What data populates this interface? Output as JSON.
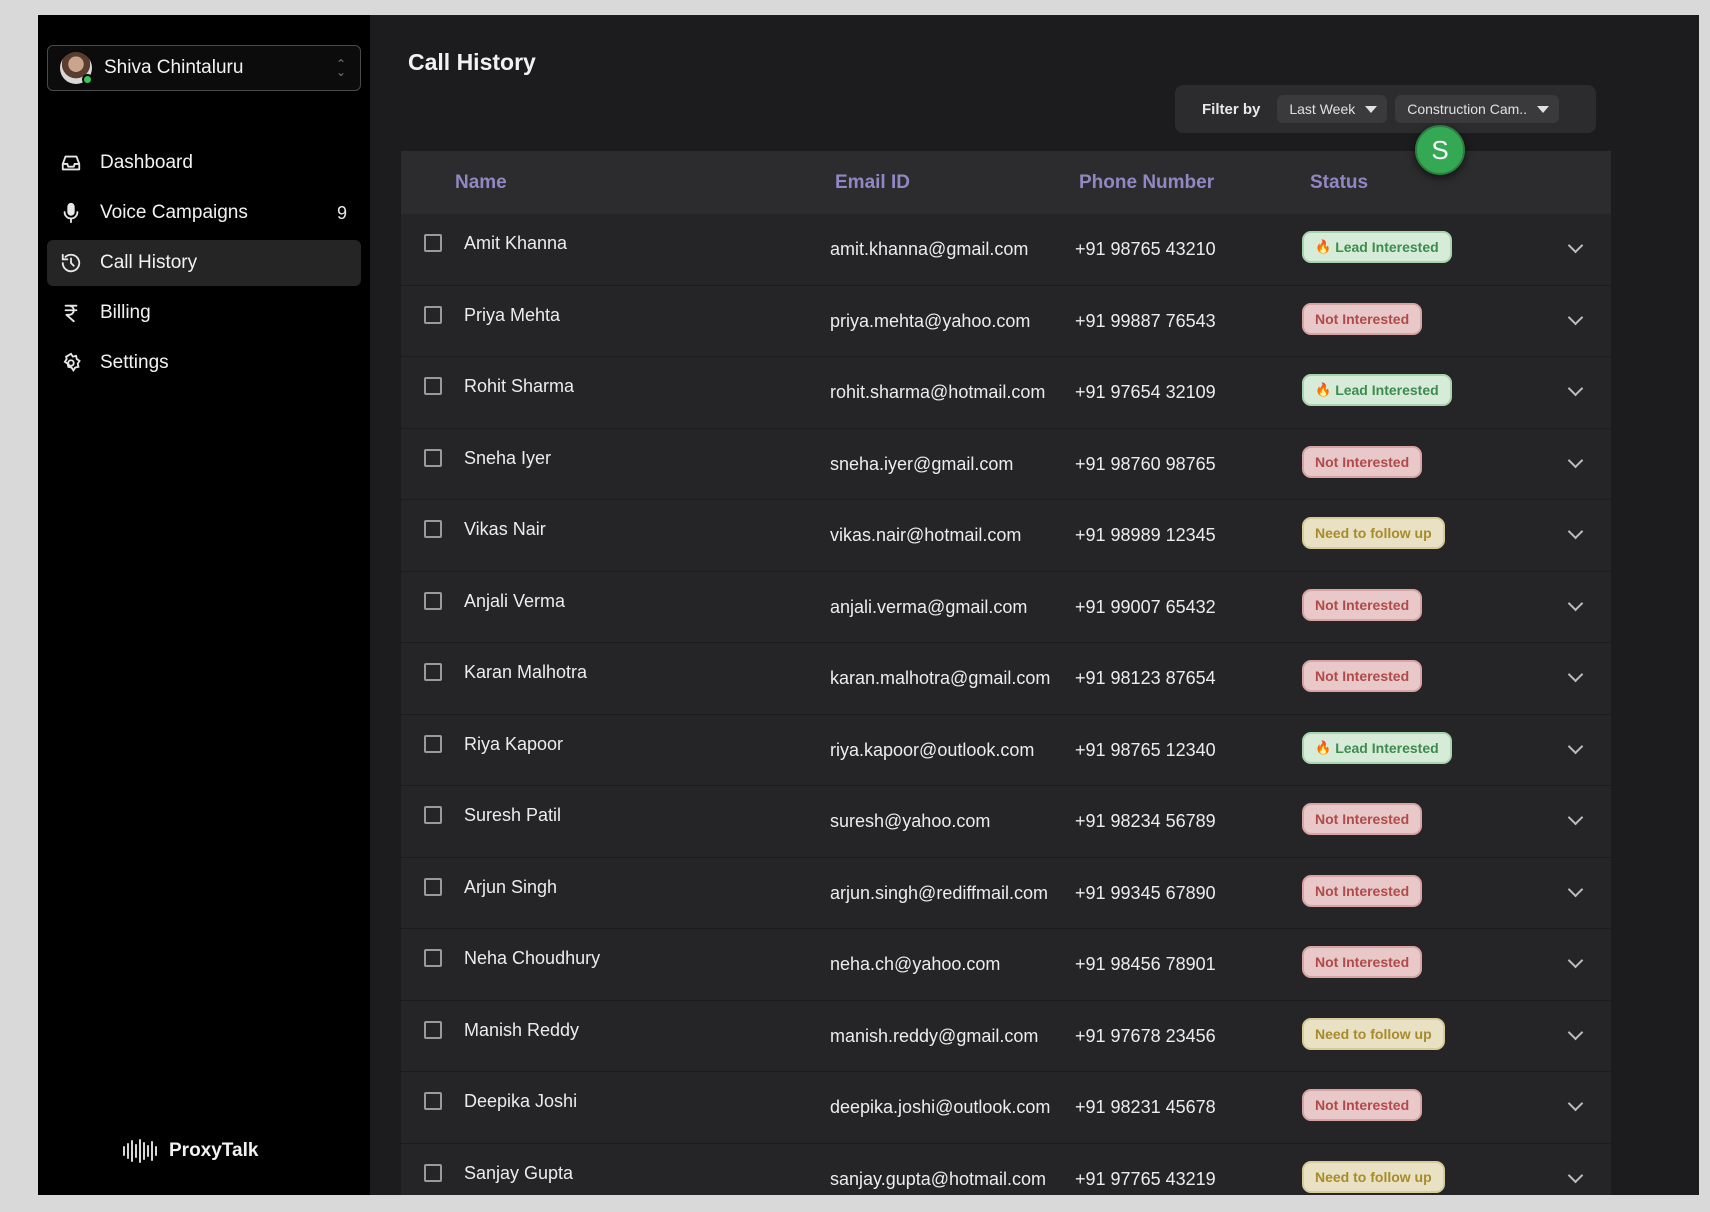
{
  "user": {
    "name": "Shiva Chintaluru"
  },
  "nav": [
    {
      "label": "Dashboard",
      "icon": "inbox-icon",
      "count": ""
    },
    {
      "label": "Voice Campaigns",
      "icon": "microphone-icon",
      "count": "9"
    },
    {
      "label": "Call History",
      "icon": "history-icon",
      "count": "",
      "active": true
    },
    {
      "label": "Billing",
      "icon": "rupee-icon",
      "count": ""
    },
    {
      "label": "Settings",
      "icon": "gear-icon",
      "count": ""
    }
  ],
  "brand": {
    "name": "ProxyTalk"
  },
  "page": {
    "title": "Call History"
  },
  "filter": {
    "label": "Filter by",
    "period": "Last Week",
    "campaign": "Construction Cam.."
  },
  "fab": {
    "initial": "S",
    "color": "#34a853"
  },
  "table": {
    "headers": {
      "name": "Name",
      "email": "Email ID",
      "phone": "Phone Number",
      "status": "Status"
    },
    "rows": [
      {
        "name": "Amit Khanna",
        "email": "amit.khanna@gmail.com",
        "phone": "+91 98765 43210",
        "status": "Lead Interested",
        "type": "lead"
      },
      {
        "name": "Priya Mehta",
        "email": "priya.mehta@yahoo.com",
        "phone": "+91 99887 76543",
        "status": "Not Interested",
        "type": "not"
      },
      {
        "name": "Rohit Sharma",
        "email": "rohit.sharma@hotmail.com",
        "phone": "+91 97654 32109",
        "status": "Lead Interested",
        "type": "lead"
      },
      {
        "name": "Sneha Iyer",
        "email": "sneha.iyer@gmail.com",
        "phone": "+91 98760 98765",
        "status": "Not Interested",
        "type": "not"
      },
      {
        "name": "Vikas Nair",
        "email": "vikas.nair@hotmail.com",
        "phone": "+91 98989 12345",
        "status": "Need to follow up",
        "type": "follow"
      },
      {
        "name": "Anjali Verma",
        "email": "anjali.verma@gmail.com",
        "phone": "+91 99007 65432",
        "status": "Not Interested",
        "type": "not"
      },
      {
        "name": "Karan Malhotra",
        "email": "karan.malhotra@gmail.com",
        "phone": "+91 98123 87654",
        "status": "Not Interested",
        "type": "not"
      },
      {
        "name": "Riya Kapoor",
        "email": "riya.kapoor@outlook.com",
        "phone": "+91 98765 12340",
        "status": "Lead Interested",
        "type": "lead"
      },
      {
        "name": "Suresh Patil",
        "email": "suresh@yahoo.com",
        "phone": "+91 98234 56789",
        "status": "Not Interested",
        "type": "not"
      },
      {
        "name": "Arjun Singh",
        "email": "arjun.singh@rediffmail.com",
        "phone": "+91 99345 67890",
        "status": "Not Interested",
        "type": "not"
      },
      {
        "name": "Neha Choudhury",
        "email": "neha.ch@yahoo.com",
        "phone": "+91 98456 78901",
        "status": "Not Interested",
        "type": "not"
      },
      {
        "name": "Manish Reddy",
        "email": "manish.reddy@gmail.com",
        "phone": "+91 97678 23456",
        "status": "Need to follow up",
        "type": "follow"
      },
      {
        "name": "Deepika Joshi",
        "email": "deepika.joshi@outlook.com",
        "phone": "+91 98231 45678",
        "status": "Not Interested",
        "type": "not"
      },
      {
        "name": "Sanjay Gupta",
        "email": "sanjay.gupta@hotmail.com",
        "phone": "+91 97765 43219",
        "status": "Need to follow up",
        "type": "follow"
      }
    ]
  },
  "colors": {
    "lead": "#3f8a4e",
    "not_interested": "#b14a4a",
    "follow_up": "#a88b2a",
    "header_text": "#9287c2"
  }
}
